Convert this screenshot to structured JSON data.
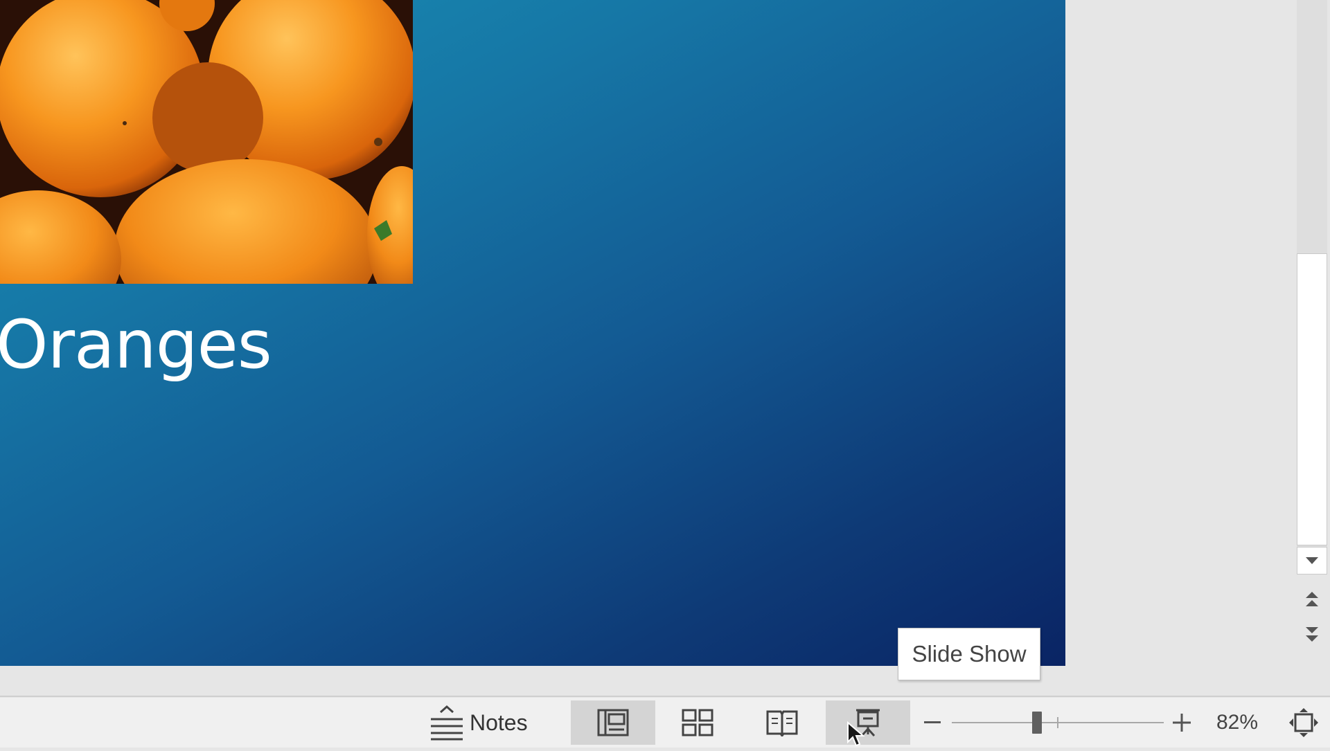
{
  "slide": {
    "title": "Oranges",
    "image_alt": "oranges photo"
  },
  "statusbar": {
    "notes_label": "Notes",
    "views": [
      {
        "name": "Normal",
        "active": true
      },
      {
        "name": "Slide Sorter",
        "active": false
      },
      {
        "name": "Reading View",
        "active": false
      },
      {
        "name": "Slide Show",
        "active": false
      }
    ],
    "zoom_percent": "82%",
    "zoom_out_symbol": "−",
    "zoom_in_symbol": "+"
  },
  "tooltip": {
    "text": "Slide Show"
  },
  "colors": {
    "slide_gradient_start": "#1a90b5",
    "slide_gradient_end": "#0a2464",
    "statusbar_bg": "#f0f0f0",
    "active_view_bg": "#d4d4d4"
  }
}
